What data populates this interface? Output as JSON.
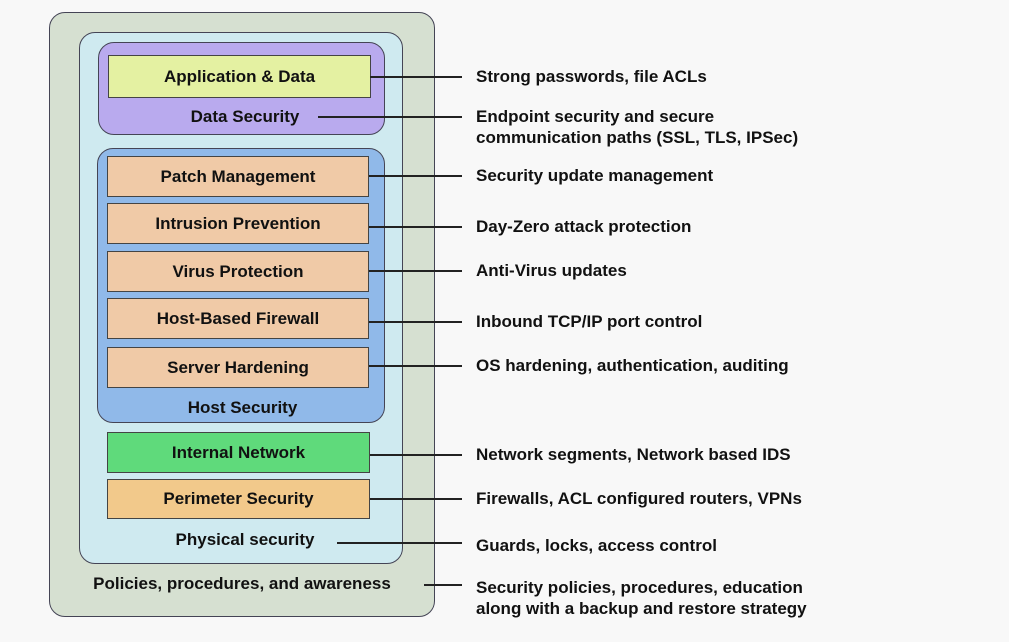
{
  "colors": {
    "policies": "#d6e0d1",
    "physical": "#cfeaf0",
    "data_security": "#b9aaee",
    "application": "#e4f1a2",
    "host_security": "#90b9e9",
    "host_item": "#f0caa7",
    "internal_network": "#5fda7b",
    "perimeter": "#f2c98b"
  },
  "layers": {
    "application": "Application & Data",
    "data_security": "Data Security",
    "host_items": [
      "Patch Management",
      "Intrusion Prevention",
      "Virus Protection",
      "Host-Based Firewall",
      "Server Hardening"
    ],
    "host_security": "Host Security",
    "internal_network": "Internal Network",
    "perimeter": "Perimeter Security",
    "physical": "Physical security",
    "policies": "Policies, procedures, and awareness"
  },
  "descriptions": {
    "application": "Strong passwords, file ACLs",
    "data_security": [
      "Endpoint security and secure",
      "communication paths (SSL, TLS, IPSec)"
    ],
    "host_items": [
      "Security update management",
      "Day-Zero attack protection",
      "Anti-Virus updates",
      "Inbound TCP/IP port control",
      "OS hardening, authentication, auditing"
    ],
    "internal_network": "Network segments, Network based IDS",
    "perimeter": "Firewalls, ACL configured routers, VPNs",
    "physical": "Guards, locks, access control",
    "policies": [
      "Security policies, procedures, education",
      "along with a  backup and restore strategy"
    ]
  }
}
